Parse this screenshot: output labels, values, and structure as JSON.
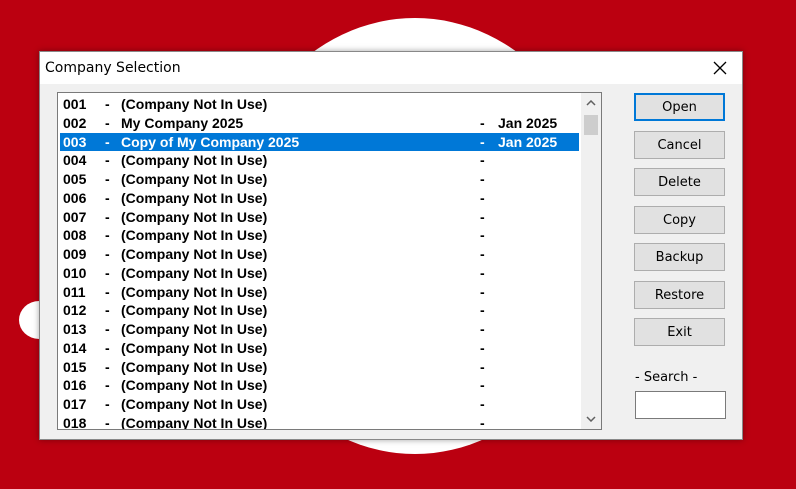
{
  "dialog": {
    "title": "Company Selection"
  },
  "companies": [
    {
      "num": "001",
      "sep": "-",
      "name": "(Company Not In Use)",
      "sep2": "",
      "date": ""
    },
    {
      "num": "002",
      "sep": "-",
      "name": "My Company 2025",
      "sep2": "-",
      "date": "Jan 2025"
    },
    {
      "num": "003",
      "sep": "-",
      "name": "Copy of My Company 2025",
      "sep2": "-",
      "date": "Jan 2025",
      "selected": true
    },
    {
      "num": "004",
      "sep": "-",
      "name": "(Company Not In Use)",
      "sep2": "-",
      "date": ""
    },
    {
      "num": "005",
      "sep": "-",
      "name": "(Company Not In Use)",
      "sep2": "-",
      "date": ""
    },
    {
      "num": "006",
      "sep": "-",
      "name": "(Company Not In Use)",
      "sep2": "-",
      "date": ""
    },
    {
      "num": "007",
      "sep": "-",
      "name": "(Company Not In Use)",
      "sep2": "-",
      "date": ""
    },
    {
      "num": "008",
      "sep": "-",
      "name": "(Company Not In Use)",
      "sep2": "-",
      "date": ""
    },
    {
      "num": "009",
      "sep": "-",
      "name": "(Company Not In Use)",
      "sep2": "-",
      "date": ""
    },
    {
      "num": "010",
      "sep": "-",
      "name": "(Company Not In Use)",
      "sep2": "-",
      "date": ""
    },
    {
      "num": "011",
      "sep": "-",
      "name": "(Company Not In Use)",
      "sep2": "-",
      "date": ""
    },
    {
      "num": "012",
      "sep": "-",
      "name": "(Company Not In Use)",
      "sep2": "-",
      "date": ""
    },
    {
      "num": "013",
      "sep": "-",
      "name": "(Company Not In Use)",
      "sep2": "-",
      "date": ""
    },
    {
      "num": "014",
      "sep": "-",
      "name": "(Company Not In Use)",
      "sep2": "-",
      "date": ""
    },
    {
      "num": "015",
      "sep": "-",
      "name": "(Company Not In Use)",
      "sep2": "-",
      "date": ""
    },
    {
      "num": "016",
      "sep": "-",
      "name": "(Company Not In Use)",
      "sep2": "-",
      "date": ""
    },
    {
      "num": "017",
      "sep": "-",
      "name": "(Company Not In Use)",
      "sep2": "-",
      "date": ""
    },
    {
      "num": "018",
      "sep": "-",
      "name": "(Company Not In Use)",
      "sep2": "-",
      "date": ""
    }
  ],
  "buttons": {
    "open": "Open",
    "cancel": "Cancel",
    "delete": "Delete",
    "copy": "Copy",
    "backup": "Backup",
    "restore": "Restore",
    "exit": "Exit"
  },
  "search": {
    "label": "- Search -",
    "value": ""
  },
  "colors": {
    "background": "#bb0010",
    "selection": "#0078d7",
    "default_button_border": "#0078d7"
  },
  "icons": {
    "close": "close-icon",
    "scroll_up": "chevron-up-icon",
    "scroll_down": "chevron-down-icon"
  }
}
